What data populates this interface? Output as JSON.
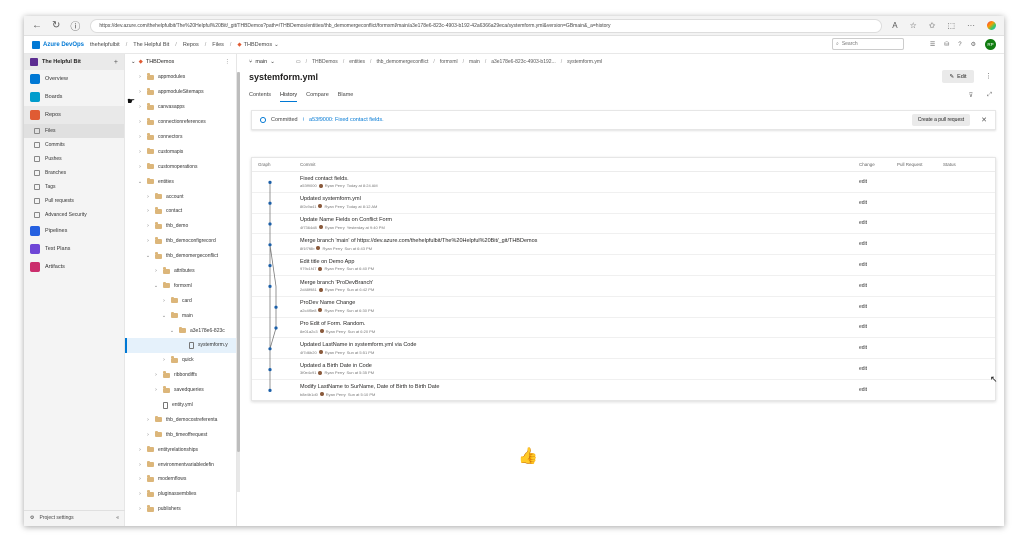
{
  "browser": {
    "url": "https://dev.azure.com/thehelpfulbit/The%20Helpful%20Bit/_git/THBDemos?path=/THBDemos/entities/thb_demomergeconflict/formxml/main/a3e178e6-823c-4903-b192-42a6366a29eca/systemform.yml&version=GBmain&_a=history"
  },
  "header": {
    "product": "Azure DevOps",
    "breadcrumbs": [
      "thehelpfulbit",
      "The Helpful Bit",
      "Repos",
      "Files",
      "THBDemos"
    ],
    "search_placeholder": "Search",
    "avatar_initials": "RP"
  },
  "leftnav": {
    "project": "The Helpful Bit",
    "items": [
      {
        "label": "Overview",
        "color": "#0078d4"
      },
      {
        "label": "Boards",
        "color": "#009ccc"
      },
      {
        "label": "Repos",
        "color": "#e05b33"
      },
      {
        "label": "Files"
      },
      {
        "label": "Commits"
      },
      {
        "label": "Pushes"
      },
      {
        "label": "Branches"
      },
      {
        "label": "Tags"
      },
      {
        "label": "Pull requests"
      },
      {
        "label": "Advanced Security"
      },
      {
        "label": "Pipelines",
        "color": "#2560e0"
      },
      {
        "label": "Test Plans",
        "color": "#6e46d6"
      },
      {
        "label": "Artifacts",
        "color": "#cb2e6d"
      }
    ],
    "project_settings": "Project settings"
  },
  "tree": {
    "repo": "THBDemos",
    "rows": [
      {
        "label": "appmodules"
      },
      {
        "label": "appmoduleSitemaps"
      },
      {
        "label": "canvasapps"
      },
      {
        "label": "connectionreferences"
      },
      {
        "label": "connectors"
      },
      {
        "label": "customapis"
      },
      {
        "label": "customoperations"
      },
      {
        "label": "entities"
      },
      {
        "label": "account"
      },
      {
        "label": "contact"
      },
      {
        "label": "thb_demo"
      },
      {
        "label": "thb_democonfigrecord"
      },
      {
        "label": "thb_demomergeconflict"
      },
      {
        "label": "attributes"
      },
      {
        "label": "formxml"
      },
      {
        "label": "card"
      },
      {
        "label": "main"
      },
      {
        "label": "a3e178e6-823c"
      },
      {
        "label": "systemform.y"
      },
      {
        "label": "quick"
      },
      {
        "label": "ribbondiffs"
      },
      {
        "label": "savedqueries"
      },
      {
        "label": "entity.yml"
      },
      {
        "label": "thb_democostreferenta"
      },
      {
        "label": "thb_timeoffrequest"
      },
      {
        "label": "entityrelationships"
      },
      {
        "label": "environmentvariabledefin"
      },
      {
        "label": "modernflows"
      },
      {
        "label": "pluginassemblies"
      },
      {
        "label": "publishers"
      }
    ]
  },
  "main": {
    "branch": "main",
    "path": [
      "THBDemos",
      "entities",
      "thb_demomergeconflict",
      "formxml",
      "main",
      "a3e178e6-823c-4903-b192...",
      "systemform.yml"
    ],
    "file_title": "systemform.yml",
    "edit_label": "Edit",
    "tabs": [
      "Contents",
      "History",
      "Compare",
      "Blame"
    ],
    "banner": {
      "prefix": "Committed",
      "link": "a53f9000: Fixed contact fields.",
      "button": "Create a pull request"
    },
    "history": {
      "columns": [
        "Graph",
        "Commit",
        "Change",
        "Pull Request",
        "Status"
      ],
      "commits": [
        {
          "message": "Fixed contact fields.",
          "hash": "a53f9000",
          "author": "Ryan Perry",
          "time": "Today at 8:24 AM",
          "change": "edit"
        },
        {
          "message": "Updated systemform.yml",
          "hash": "8f2c9a41",
          "author": "Ryan Perry",
          "time": "Today at 8:12 AM",
          "change": "edit"
        },
        {
          "message": "Update Name Fields on Conflict Form",
          "hash": "4f7364d8",
          "author": "Ryan Perry",
          "time": "Yesterday at 9:40 PM",
          "change": "edit"
        },
        {
          "message": "Merge branch 'main' of https://dev.azure.com/thehelpfulbit/The%20Helpful%20Bit/_git/THBDemos",
          "hash": "8f1f7f8b",
          "author": "Ryan Perry",
          "time": "Sun at 6:43 PM",
          "change": "edit"
        },
        {
          "message": "Edit title on Demo App",
          "hash": "979c1f47",
          "author": "Ryan Perry",
          "time": "Sun at 6:40 PM",
          "change": "edit"
        },
        {
          "message": "Merge branch 'ProDevBranch'",
          "hash": "2d48f981",
          "author": "Ryan Perry",
          "time": "Sun at 6:42 PM",
          "change": "edit"
        },
        {
          "message": "ProDev Name Change",
          "hash": "a2c4f5e8",
          "author": "Ryan Perry",
          "time": "Sun at 6:30 PM",
          "change": "edit"
        },
        {
          "message": "Pro Edit of Form. Random.",
          "hash": "8e01a2c3",
          "author": "Ryan Perry",
          "time": "Sun at 6:20 PM",
          "change": "edit"
        },
        {
          "message": "Updated LastName in systemform.yml via Code",
          "hash": "4f7d6b20",
          "author": "Ryan Perry",
          "time": "Sun at 5:51 PM",
          "change": "edit"
        },
        {
          "message": "Updated a Birth Date in Code",
          "hash": "3f0e4c91",
          "author": "Ryan Perry",
          "time": "Sun at 5:35 PM",
          "change": "edit"
        },
        {
          "message": "Modify LastName to SurName, Date of Birth to Birth Date",
          "hash": "b8e4b1d0",
          "author": "Ryan Perry",
          "time": "Sun at 5:10 PM",
          "change": "edit"
        }
      ]
    }
  }
}
